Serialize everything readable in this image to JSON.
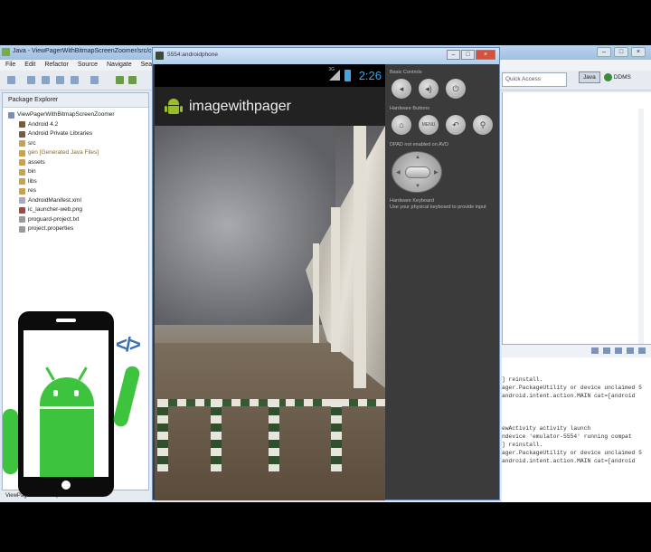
{
  "eclipse": {
    "title": "Java - ViewPagerWithBitmapScreenZoomer/src/com/...",
    "window_controls": [
      "–",
      "□",
      "×"
    ],
    "menu": [
      "File",
      "Edit",
      "Refactor",
      "Source",
      "Navigate",
      "Search"
    ],
    "package_explorer": {
      "title": "Package Explorer",
      "project": "ViewPagerWithBitmapScreenZoomer",
      "items": [
        "Android 4.2",
        "Android Private Libraries",
        "src",
        "gen [Generated Java Files]",
        "assets",
        "bin",
        "libs",
        "res",
        "AndroidManifest.xml",
        "ic_launcher-web.png",
        "proguard-project.txt",
        "project.properties"
      ]
    },
    "status_bar": "ViewPagerWithBitmapScreenZoomer",
    "quick_access_placeholder": "Quick Access",
    "perspectives": [
      "Java",
      "DDMS"
    ],
    "console_lines": [
      "] reinstall.",
      "ager.PackageUtility or device unclaimed 5",
      "android.intent.action.MAIN cat=[android",
      "",
      "",
      "ewActivity activity launch",
      "ndevice 'emulator-5554' running compat",
      "] reinstall.",
      "ager.PackageUtility or device unclaimed 5",
      "android.intent.action.MAIN cat=[android"
    ]
  },
  "emulator": {
    "title": "5554:androidphone",
    "window_controls": [
      "–",
      "□",
      "×"
    ],
    "status": {
      "network": "3G",
      "time": "2:26"
    },
    "app_title": "imagewithpager",
    "controls": {
      "basic_label": "Basic Controls",
      "hardware_label": "Hardware Buttons",
      "dpad_label": "DPAD not enabled on AVD",
      "keyboard_label": "Hardware Keyboard",
      "keyboard_hint": "Use your physical keyboard to provide input",
      "basic_buttons": [
        "volume-down",
        "volume-up",
        "power"
      ],
      "hardware_buttons": [
        "home",
        "menu",
        "back",
        "search"
      ],
      "menu_text": "MENU"
    }
  },
  "overlay_logo": {
    "code_symbol": "</>"
  },
  "colors": {
    "android_green": "#3ec33e",
    "clock_blue": "#3fa6e8",
    "code_blue": "#3c6fb5"
  }
}
